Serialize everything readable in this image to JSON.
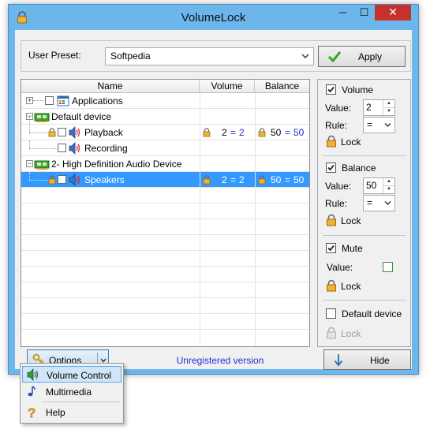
{
  "window": {
    "title": "VolumeLock",
    "controls": {
      "minimize": "─",
      "maximize": "☐",
      "close": "✕"
    }
  },
  "preset": {
    "label": "User Preset:",
    "selected": "Softpedia",
    "apply_label": "Apply"
  },
  "tree": {
    "columns": [
      "Name",
      "Volume",
      "Balance"
    ],
    "rows": [
      {
        "label": "Applications",
        "icon": "application-window-icon",
        "volume": "",
        "balance": ""
      },
      {
        "label": "Default device",
        "icon": "sound-card-icon",
        "volume": "",
        "balance": ""
      },
      {
        "label": "Playback",
        "icon": "speaker-icon",
        "volume_a": "2",
        "volume_b": "2",
        "balance_a": "50",
        "balance_b": "50"
      },
      {
        "label": "Recording",
        "icon": "speaker-icon",
        "volume": "",
        "balance": ""
      },
      {
        "label": "2- High Definition Audio Device",
        "icon": "sound-card-icon",
        "volume": "",
        "balance": ""
      },
      {
        "label": "Speakers",
        "icon": "speaker-icon",
        "volume_a": "2",
        "volume_b": "2",
        "balance_a": "50",
        "balance_b": "50",
        "selected": true
      }
    ],
    "equals": "="
  },
  "right_panel": {
    "volume": {
      "label": "Volume",
      "checked": true,
      "value_label": "Value:",
      "value": "2",
      "rule_label": "Rule:",
      "rule": "=",
      "lock_label": "Lock"
    },
    "balance": {
      "label": "Balance",
      "checked": true,
      "value_label": "Value:",
      "value": "50",
      "rule_label": "Rule:",
      "rule": "=",
      "lock_label": "Lock"
    },
    "mute": {
      "label": "Mute",
      "checked": true,
      "value_label": "Value:",
      "value_checked": false,
      "lock_label": "Lock"
    },
    "default_device": {
      "label": "Default device",
      "checked": false,
      "lock_label": "Lock"
    }
  },
  "bottom": {
    "options_label": "Options",
    "unregistered": "Unregistered version",
    "hide_label": "Hide"
  },
  "options_menu": {
    "items": [
      {
        "label": "Volume Control",
        "icon": "volume-control-icon",
        "highlighted": true
      },
      {
        "label": "Multimedia",
        "icon": "music-note-icon"
      },
      {
        "label": "Help",
        "icon": "help-icon"
      }
    ]
  },
  "colors": {
    "window_frame": "#6db6ec",
    "selection": "#3399ff",
    "link_blue": "#1d2fd3",
    "close_button": "#c7312b"
  }
}
